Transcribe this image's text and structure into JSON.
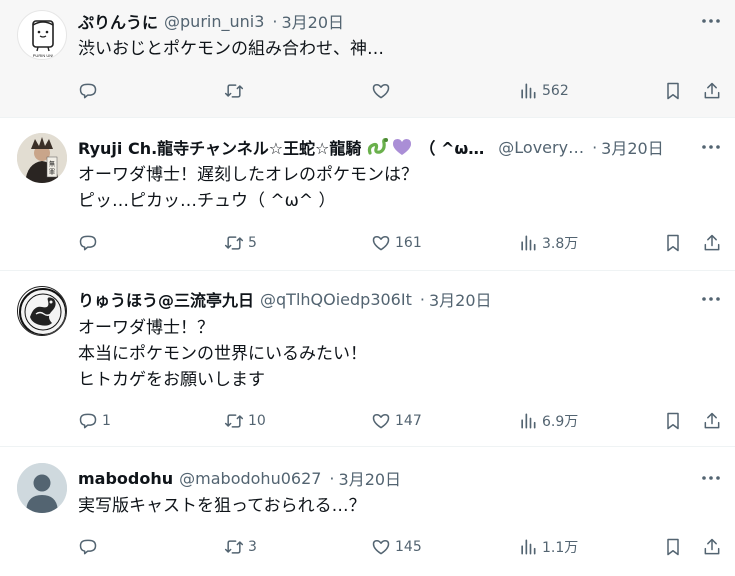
{
  "tweets": [
    {
      "name": "ぷりんうに",
      "handle": "@purin_uni3",
      "sep": "·",
      "date": "3月20日",
      "text": "渋いおじとポケモンの組み合わせ、神…",
      "reply_count": "",
      "retweet_count": "",
      "like_count": "",
      "view_count": "562"
    },
    {
      "name": "Ryuji Ch.龍寺チャンネル☆王蛇☆龍騎",
      "name_suffix": "（ ^ω…",
      "handle": "@Lovery…",
      "sep": "·",
      "date": "3月20日",
      "text": "オーワダ博士！遅刻したオレのポケモンは？\nピッ…ピカッ…チュウ（ ^ω^ ）",
      "reply_count": "",
      "retweet_count": "5",
      "like_count": "161",
      "view_count": "3.8万"
    },
    {
      "name": "りゅうほう@三流亭九日",
      "handle": "@qTlhQOiedp306It",
      "sep": "·",
      "date": "3月20日",
      "text": "オーワダ博士！？\n本当にポケモンの世界にいるみたい！\nヒトカゲをお願いします",
      "reply_count": "1",
      "retweet_count": "10",
      "like_count": "147",
      "view_count": "6.9万"
    },
    {
      "name": "mabodohu",
      "handle": "@mabodohu0627",
      "sep": "·",
      "date": "3月20日",
      "text": "実写版キャストを狙っておられる…？",
      "reply_count": "",
      "retweet_count": "3",
      "like_count": "145",
      "view_count": "1.1万"
    }
  ],
  "avatar_1_label": "PURIN UNI",
  "avatar_2_label": "無罪",
  "colors": {
    "text": "#0f1419",
    "muted": "#536471",
    "divider": "#eff3f4",
    "hover_bg": "#f7f7f7"
  },
  "icons": [
    "reply-icon",
    "retweet-icon",
    "like-icon",
    "views-icon",
    "bookmark-icon",
    "share-icon",
    "more-icon"
  ]
}
